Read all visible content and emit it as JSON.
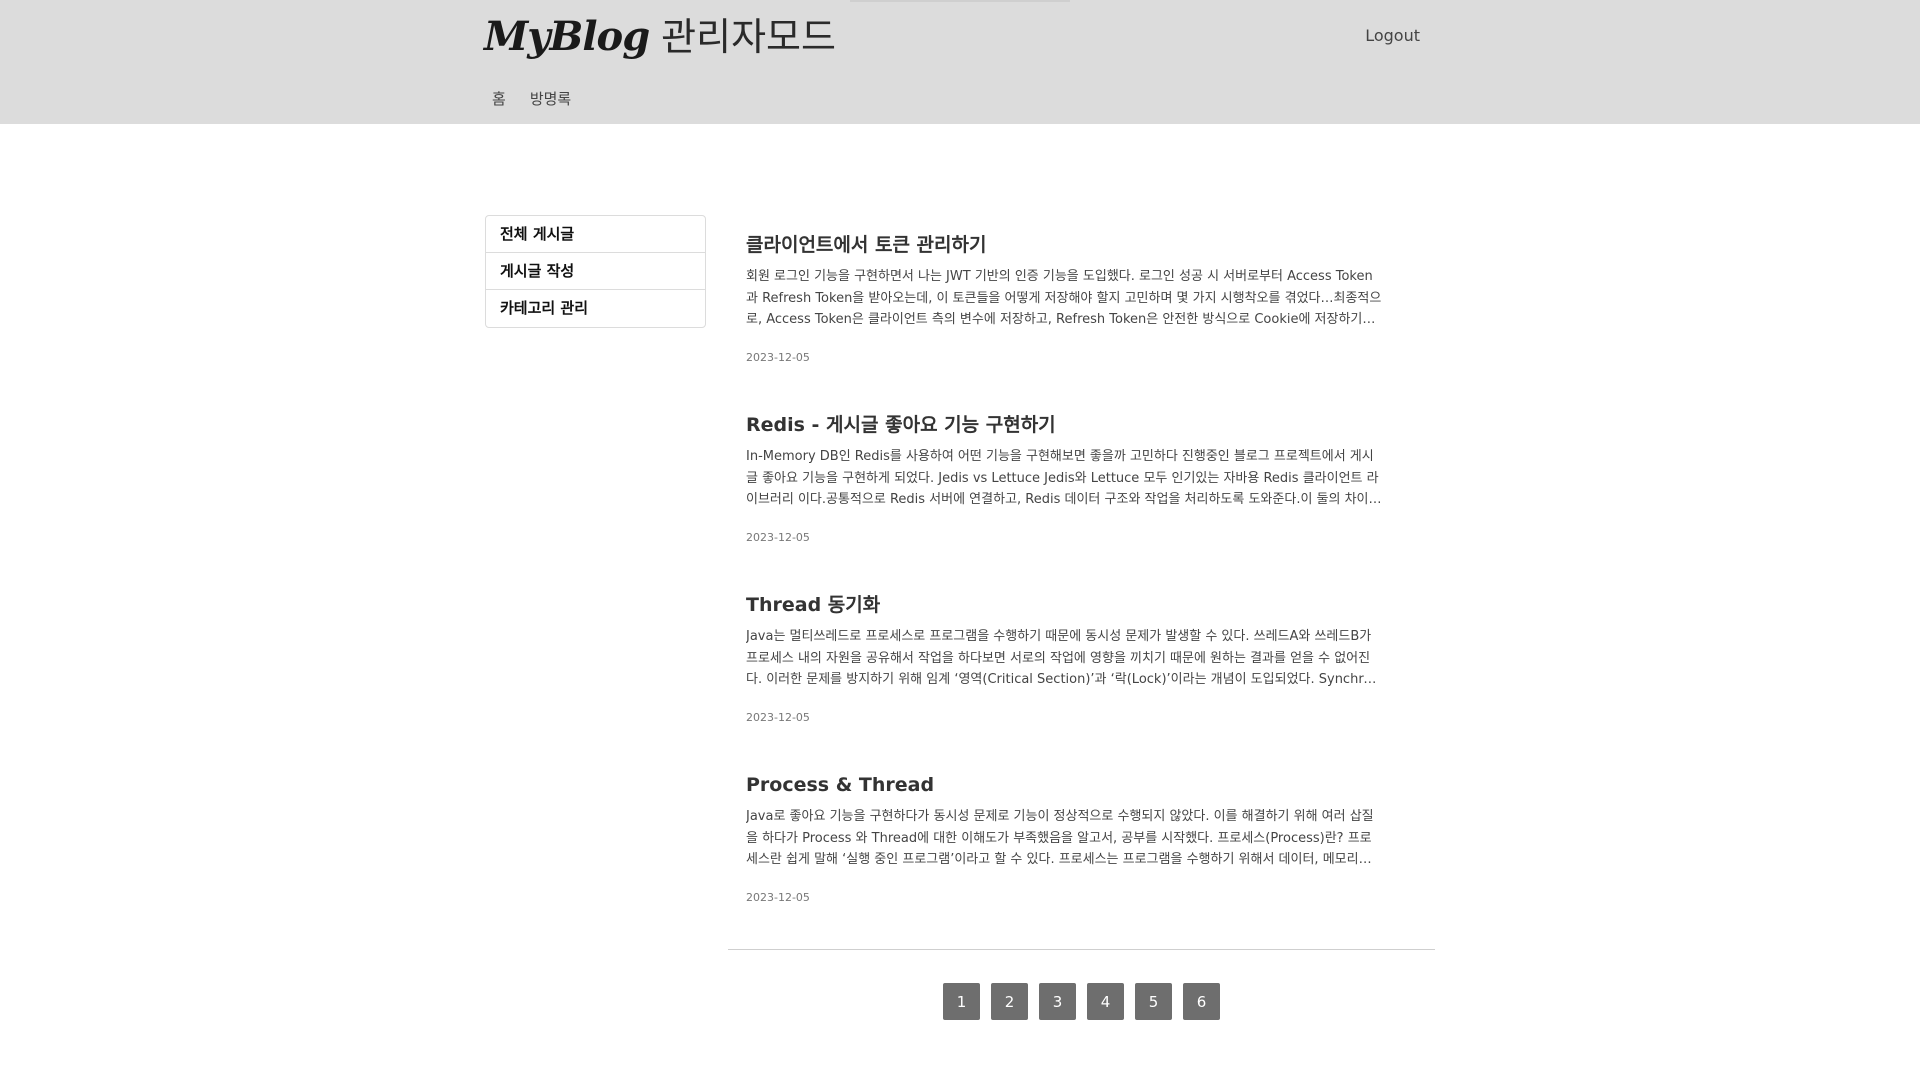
{
  "header": {
    "logo": "MyBlog",
    "mode": "관리자모드",
    "logout_label": "Logout",
    "nav": [
      {
        "label": "홈"
      },
      {
        "label": "방명록"
      }
    ]
  },
  "sidebar": {
    "items": [
      {
        "label": "전체 게시글"
      },
      {
        "label": "게시글 작성"
      },
      {
        "label": "카테고리 관리"
      }
    ]
  },
  "posts": [
    {
      "title": "클라이언트에서 토큰 관리하기",
      "excerpt": "회원 로그인 기능을 구현하면서 나는 JWT 기반의 인증 기능을 도입했다. 로그인 성공 시 서버로부터 Access Token과 Refresh Token을 받아오는데, 이 토큰들을 어떻게 저장해야 할지 고민하며 몇 가지 시행착오를 겪었다…최종적으로, Access Token은 클라이언트 측의 변수에 저장하고, Refresh Token은 안전한 방식으로 Cookie에 저장하기로 결정했다. …",
      "date": "2023-12-05"
    },
    {
      "title": "Redis - 게시글 좋아요 기능 구현하기",
      "excerpt": "In-Memory DB인 Redis를 사용하여 어떤 기능을 구현해보면 좋을까 고민하다 진행중인 블로그 프로젝트에서 게시글 좋아요 기능을 구현하게 되었다. Jedis vs Lettuce Jedis와 Lettuce 모두 인기있는 자바용 Redis 클라이언트 라이브러리 이다.공통적으로 Redis 서버에 연결하고, Redis 데이터 구조와 작업을 처리하도록 도와준다.이 둘의 차이점을 알아보고, 현재 프로젝…",
      "date": "2023-12-05"
    },
    {
      "title": "Thread 동기화",
      "excerpt": "Java는 멀티쓰레드로 프로세스로 프로그램을 수행하기 때문에 동시성 문제가 발생할 수 있다. 쓰레드A와 쓰레드B가 프로세스 내의 자원을 공유해서 작업을 하다보면 서로의 작업에 영향을 끼치기 때문에 원하는 결과를 얻을 수 없어진다. 이러한 문제를 방지하기 위해 임계 ‘영역(Critical Section)’과 ‘락(Lock)’이라는 개념이 도입되었다. Synchronized를 이용한 동기화…",
      "date": "2023-12-05"
    },
    {
      "title": "Process & Thread",
      "excerpt": "Java로 좋아요 기능을 구현하다가 동시성 문제로 기능이 정상적으로 수행되지 않았다. 이를 해결하기 위해 여러 삽질을 하다가 Process 와 Thread에 대한 이해도가 부족했음을 알고서, 공부를 시작했다. 프로세스(Process)란? 프로세스란 쉽게 말해 ‘실행 중인 프로그램’이라고 할 수 있다. 프로세스는 프로그램을 수행하기 위해서 데이터, 메모리등의 자원과 쓰레드로 구성…",
      "date": "2023-12-05"
    }
  ],
  "pagination": {
    "pages": [
      "1",
      "2",
      "3",
      "4",
      "5",
      "6"
    ]
  }
}
